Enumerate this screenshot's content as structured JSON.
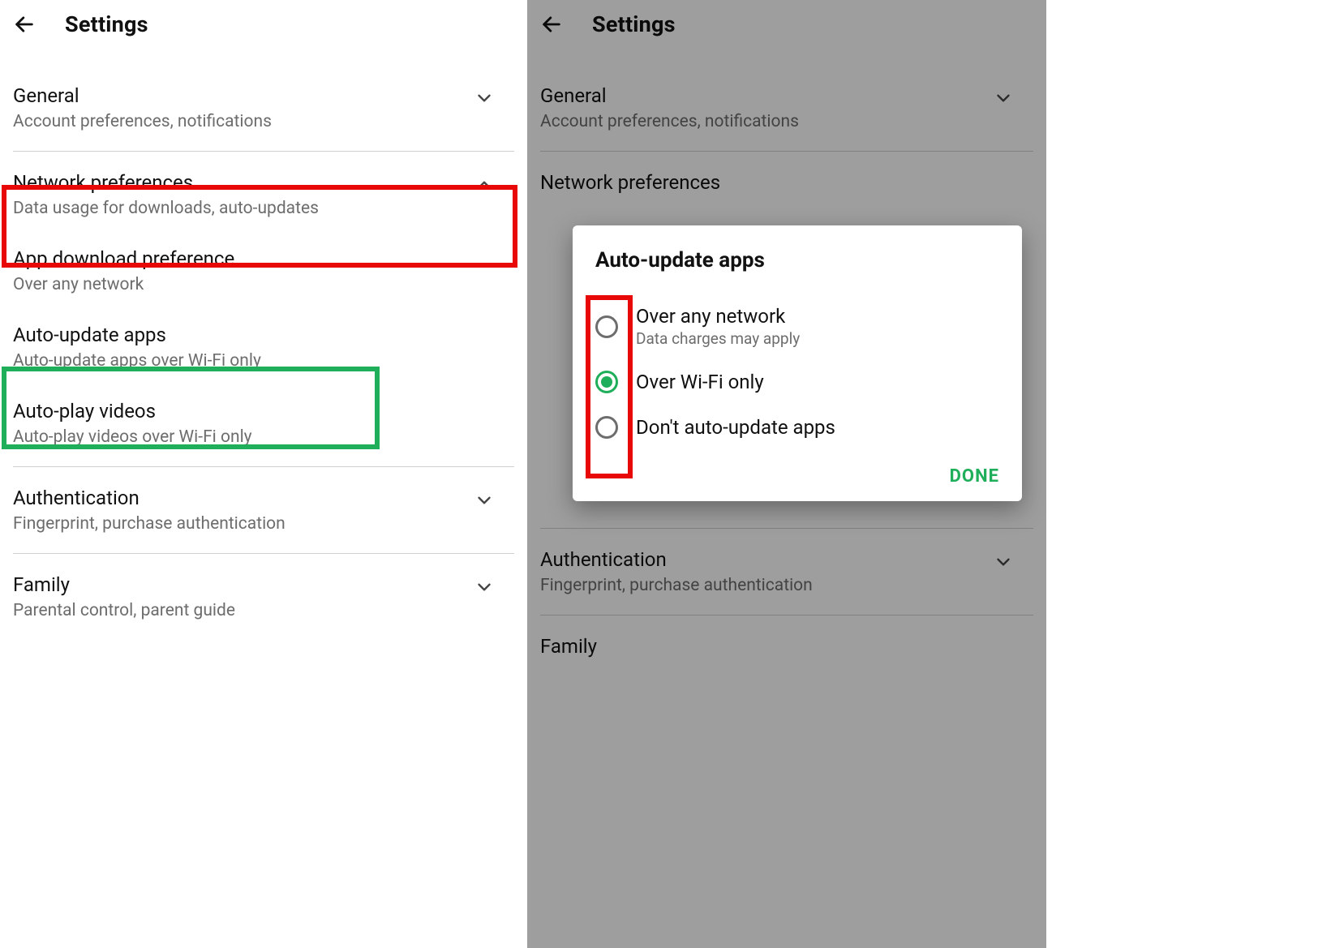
{
  "left": {
    "header_title": "Settings",
    "rows": {
      "general": {
        "title": "General",
        "sub": "Account preferences, notifications"
      },
      "network": {
        "title": "Network preferences",
        "sub": "Data usage for downloads, auto-updates"
      },
      "download": {
        "title": "App download preference",
        "sub": "Over any network"
      },
      "autoupd": {
        "title": "Auto-update apps",
        "sub": "Auto-update apps over Wi-Fi only"
      },
      "autoplay": {
        "title": "Auto-play videos",
        "sub": "Auto-play videos over Wi-Fi only"
      },
      "auth": {
        "title": "Authentication",
        "sub": "Fingerprint, purchase authentication"
      },
      "family": {
        "title": "Family",
        "sub": "Parental control, parent guide"
      }
    }
  },
  "right": {
    "header_title": "Settings",
    "rows": {
      "general": {
        "title": "General",
        "sub": "Account preferences, notifications"
      },
      "network": {
        "title": "Network preferences"
      },
      "auth": {
        "title": "Authentication",
        "sub": "Fingerprint, purchase authentication"
      },
      "family": {
        "title": "Family"
      }
    },
    "dialog": {
      "title": "Auto-update apps",
      "opts": {
        "any": {
          "label": "Over any network",
          "sub": "Data charges may apply"
        },
        "wifi": {
          "label": "Over Wi-Fi only"
        },
        "off": {
          "label": "Don't auto-update apps"
        }
      },
      "done": "DONE"
    }
  }
}
